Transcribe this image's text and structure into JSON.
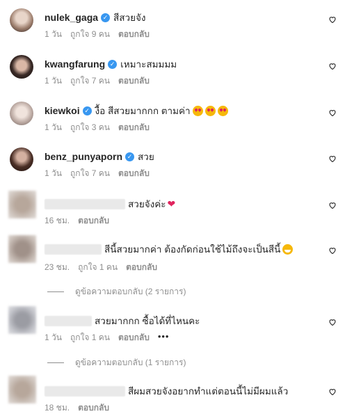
{
  "comments": [
    {
      "username": "nulek_gaga",
      "text": "สีสวยจัง",
      "time": "1 วัน",
      "likes": "ถูกใจ 9 คน",
      "reply": "ตอบกลับ"
    },
    {
      "username": "kwangfarung",
      "text": "เหมาะสมมมม",
      "time": "1 วัน",
      "likes": "ถูกใจ 7 คน",
      "reply": "ตอบกลับ"
    },
    {
      "username": "kiewkoi",
      "text": "งื้อ สีสวยมากกก ตามค่า",
      "time": "1 วัน",
      "likes": "ถูกใจ 3 คน",
      "reply": "ตอบกลับ"
    },
    {
      "username": "benz_punyaporn",
      "text": "สวย",
      "time": "1 วัน",
      "likes": "ถูกใจ 7 คน",
      "reply": "ตอบกลับ"
    },
    {
      "text": "สวยจังค่ะ",
      "time": "16 ชม.",
      "reply": "ตอบกลับ"
    },
    {
      "text": "สีนี้สวยมากค่า ต้องกัดก่อนใช้ไม้ถึงจะเป็นสีนี้",
      "time": "23 ชม.",
      "likes": "ถูกใจ 1 คน",
      "reply": "ตอบกลับ",
      "view_replies": "ดูข้อความตอบกลับ (2 รายการ)"
    },
    {
      "text": "สวยมากกก ซื้อได้ที่ไหนคะ",
      "time": "1 วัน",
      "likes": "ถูกใจ 1 คน",
      "reply": "ตอบกลับ",
      "more": "•••",
      "view_replies": "ดูข้อความตอบกลับ (1 รายการ)"
    },
    {
      "text": "สีผมสวยจังอยากทำแต่ตอนนี้ไม่มีผมแล้ว",
      "time": "18 ชม.",
      "reply": "ตอบกลับ"
    }
  ],
  "icons": {
    "verified": "verified-badge-icon",
    "like": "heart-outline-icon"
  },
  "colors": {
    "verified": "#3897f0",
    "muted": "#8e8e8e",
    "text": "#262626"
  }
}
